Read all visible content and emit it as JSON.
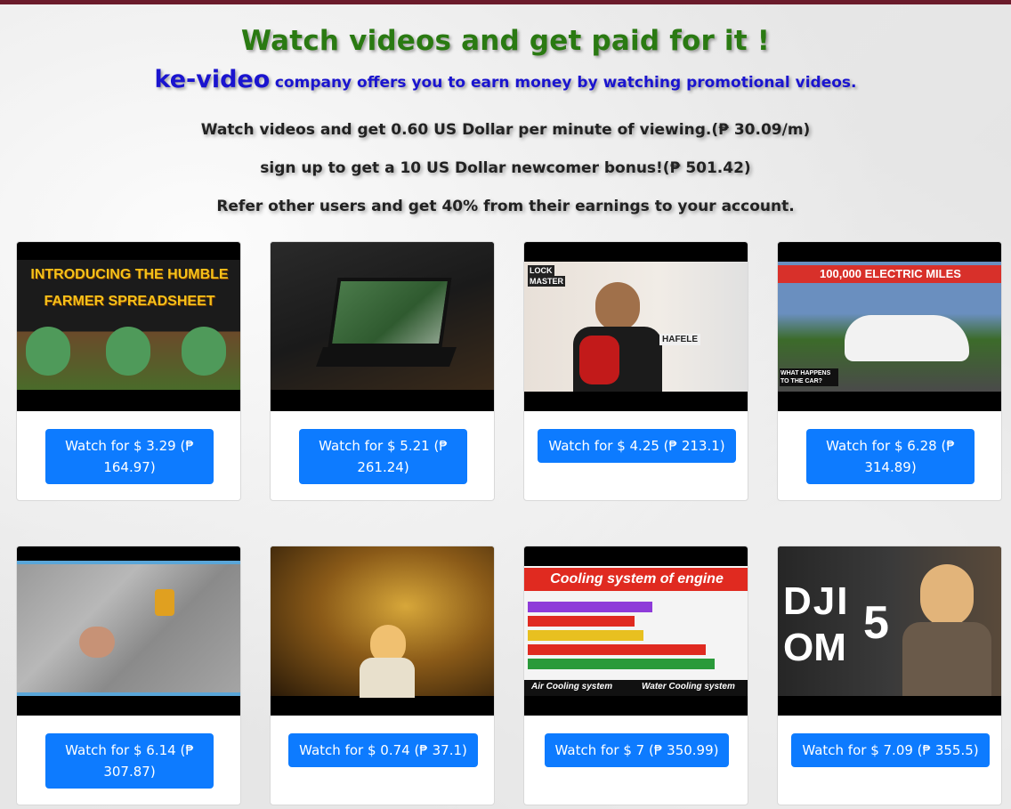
{
  "header": {
    "title": "Watch videos and get paid for it !",
    "brand": "ke-video",
    "tagline": "company offers you to earn money by watching promotional videos.",
    "rate_line": "Watch videos and get 0.60 US Dollar per minute of viewing.(₱ 30.09/m)",
    "bonus_line": "sign up to get a 10 US Dollar newcomer bonus!(₱ 501.42)",
    "referral_line": "Refer other users and get 40% from their earnings to your account."
  },
  "videos": [
    {
      "button": "Watch for $ 3.29 (₱ 164.97)",
      "thumb_text": [
        "INTRODUCING THE HUMBLE",
        "FARMER SPREADSHEET"
      ]
    },
    {
      "button": "Watch for $ 5.21 (₱ 261.24)"
    },
    {
      "button": "Watch for $ 4.25 (₱ 213.1)",
      "thumb_text": [
        "LOCK",
        "MASTER",
        "HAFELE"
      ]
    },
    {
      "button": "Watch for $ 6.28 (₱ 314.89)",
      "thumb_text": [
        "100,000 ELECTRIC MILES",
        "WHAT HAPPENS TO THE CAR?"
      ]
    },
    {
      "button": "Watch for $ 6.14 (₱ 307.87)"
    },
    {
      "button": "Watch for $ 0.74 (₱ 37.1)"
    },
    {
      "button": "Watch for $ 7 (₱ 350.99)",
      "thumb_text": [
        "Cooling system of engine",
        "Air Cooling system",
        "Water Cooling system"
      ]
    },
    {
      "button": "Watch for $ 7.09 (₱ 355.5)",
      "thumb_text": [
        "DJI",
        "OM",
        "5"
      ]
    }
  ],
  "colors": {
    "title": "#2a7a12",
    "brand": "#1a14cf",
    "button": "#0d7bff",
    "topbar": "#6b1b2b"
  }
}
